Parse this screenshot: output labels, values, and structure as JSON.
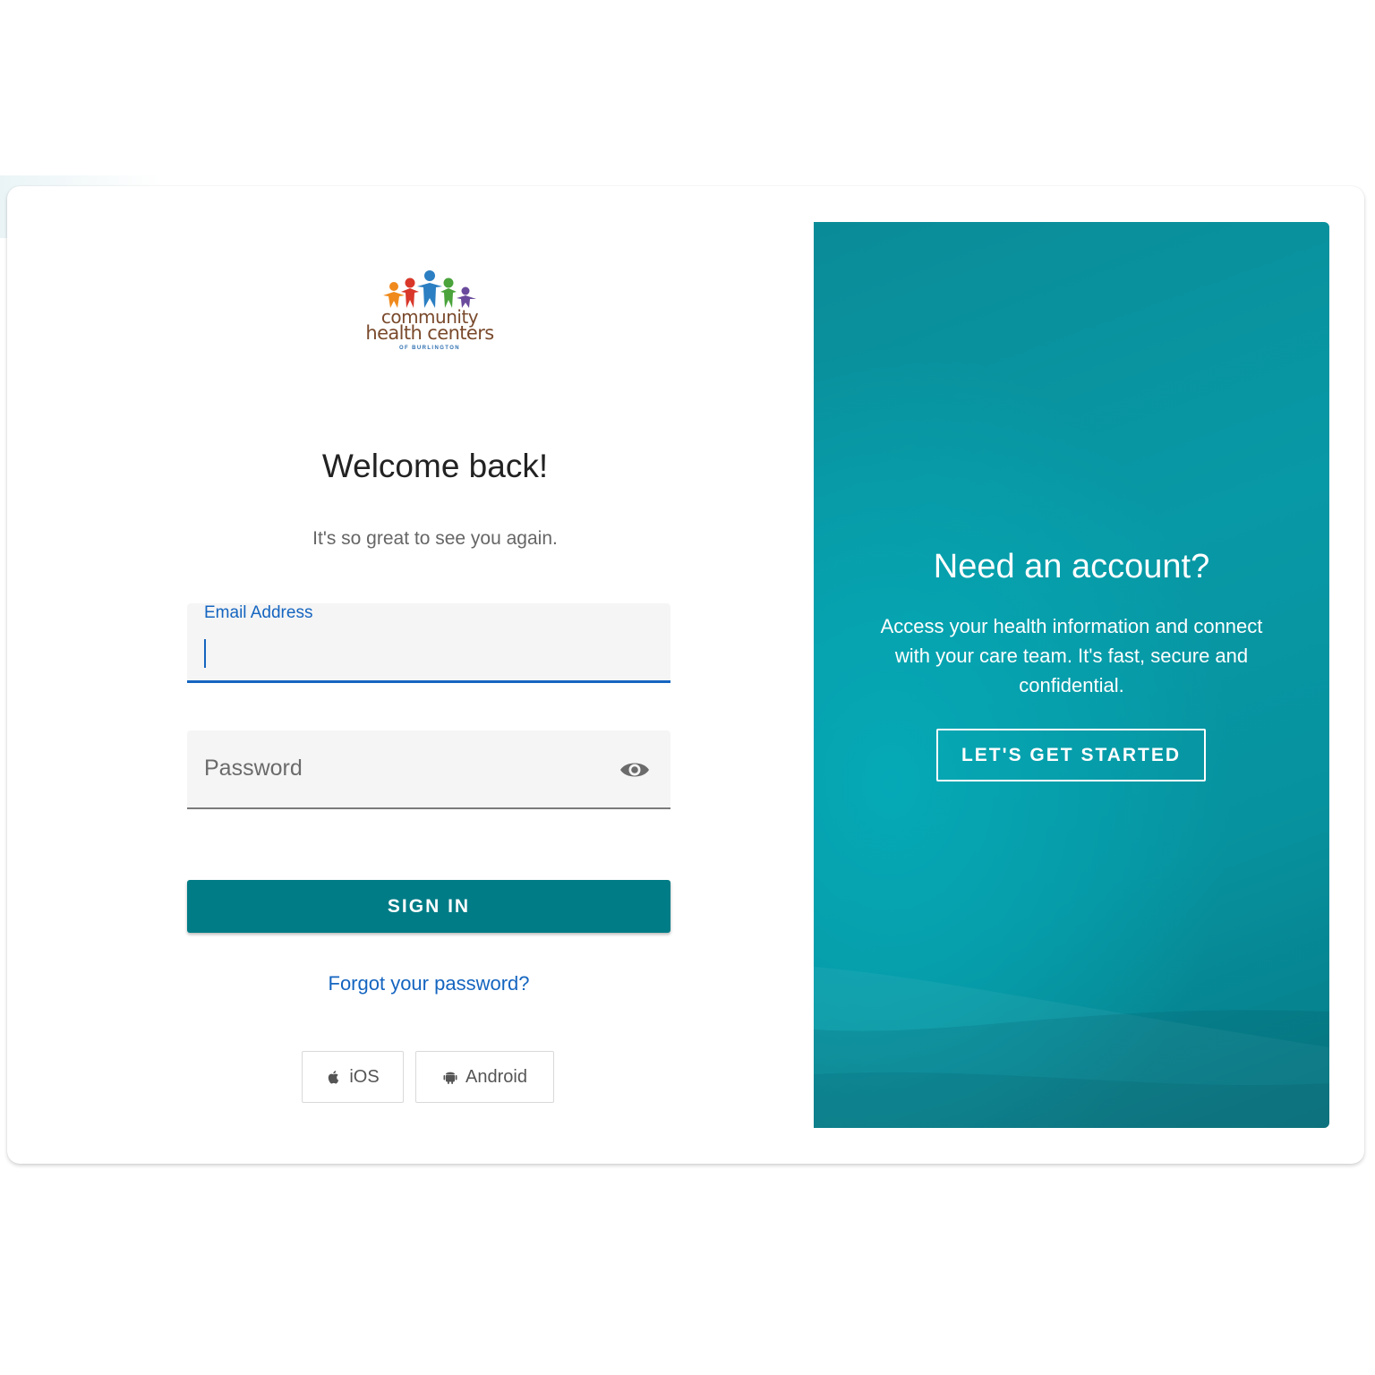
{
  "brand": {
    "logo_line1": "community",
    "logo_line2": "health centers",
    "logo_line3": "OF BURLINGTON"
  },
  "login": {
    "heading": "Welcome back!",
    "subheading": "It's so great to see you again.",
    "email": {
      "label": "Email Address",
      "value": ""
    },
    "password": {
      "placeholder": "Password",
      "value": ""
    },
    "sign_in_label": "SIGN IN",
    "forgot_label": "Forgot your password?",
    "apps": [
      {
        "label": "iOS",
        "icon": "apple-icon"
      },
      {
        "label": "Android",
        "icon": "android-icon"
      }
    ]
  },
  "signup": {
    "heading": "Need an account?",
    "description": "Access your health information and connect with your care team. It's fast, secure and confidential.",
    "cta_label": "LET'S GET STARTED"
  },
  "colors": {
    "accent_blue": "#1565c0",
    "primary_teal": "#007c86",
    "panel_teal": "#0899a6"
  }
}
